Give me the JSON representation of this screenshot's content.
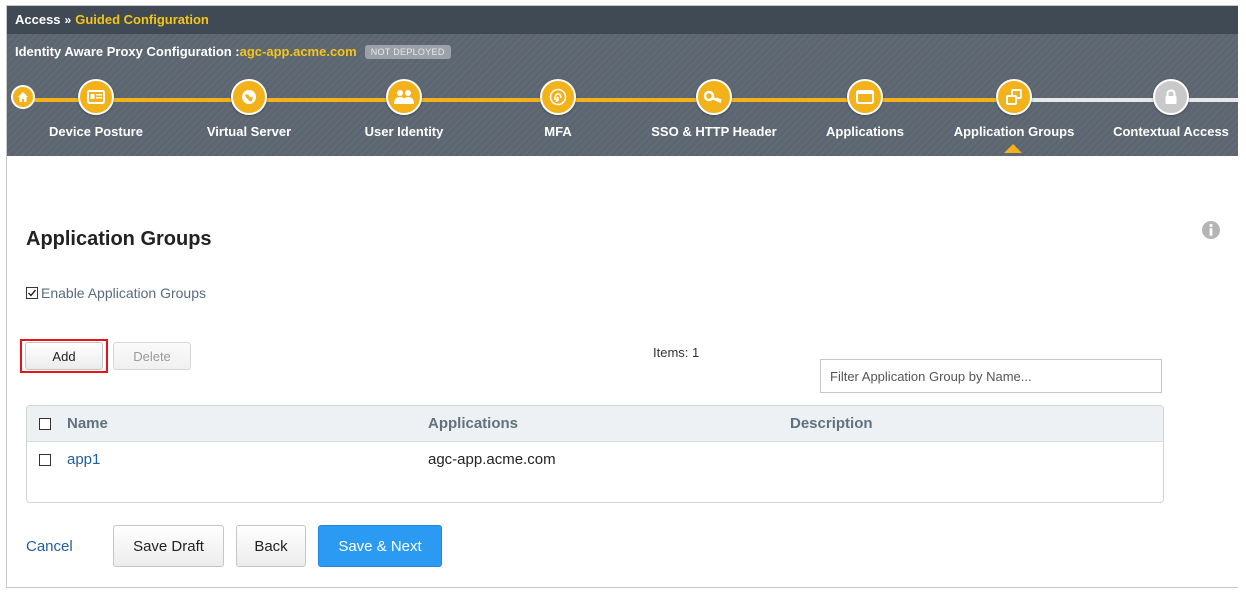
{
  "breadcrumb": {
    "root": "Access",
    "separator": "»",
    "current": "Guided Configuration"
  },
  "header": {
    "title_prefix": "Identity Aware Proxy Configuration :",
    "app_name": "agc-app.acme.com",
    "deploy_status": "NOT DEPLOYED"
  },
  "steps": [
    {
      "label": "Device Posture",
      "icon": "id-card-icon",
      "state": "done"
    },
    {
      "label": "Virtual Server",
      "icon": "globe-icon",
      "state": "done"
    },
    {
      "label": "User Identity",
      "icon": "users-icon",
      "state": "done"
    },
    {
      "label": "MFA",
      "icon": "fingerprint-icon",
      "state": "done"
    },
    {
      "label": "SSO & HTTP Header",
      "icon": "key-icon",
      "state": "done"
    },
    {
      "label": "Applications",
      "icon": "window-icon",
      "state": "done"
    },
    {
      "label": "Application Groups",
      "icon": "app-groups-icon",
      "state": "current"
    },
    {
      "label": "Contextual Access",
      "icon": "lock-icon",
      "state": "locked"
    }
  ],
  "page": {
    "title": "Application Groups",
    "enable_label": "Enable Application Groups",
    "enable_checked": true
  },
  "toolbar": {
    "add_label": "Add",
    "delete_label": "Delete",
    "items_count": "Items: 1",
    "filter_placeholder": "Filter Application Group by Name..."
  },
  "table": {
    "columns": [
      "Name",
      "Applications",
      "Description"
    ],
    "rows": [
      {
        "name": "app1",
        "applications": "agc-app.acme.com",
        "description": ""
      }
    ]
  },
  "footer": {
    "cancel_label": "Cancel",
    "save_draft_label": "Save Draft",
    "back_label": "Back",
    "save_next_label": "Save & Next"
  },
  "colors": {
    "accent": "#f3b11a",
    "header_bg": "#5c6670",
    "primary_button": "#2b9af3",
    "link": "#1f5f9e",
    "highlight": "#e8141b"
  }
}
